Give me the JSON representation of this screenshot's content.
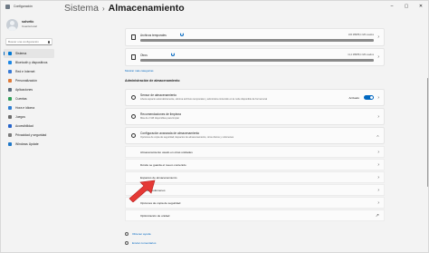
{
  "window": {
    "title": "Configuración",
    "controls": {
      "minimize": "–",
      "maximize": "▢",
      "close": "✕"
    }
  },
  "user": {
    "name": "solvetic",
    "subtitle": "Cuenta local"
  },
  "search": {
    "placeholder": "Buscar una configuración"
  },
  "sidebar": {
    "items": [
      {
        "label": "Sistema",
        "color": "#0078d4",
        "active": true
      },
      {
        "label": "Bluetooth y dispositivos",
        "color": "#1e88e5"
      },
      {
        "label": "Red e Internet",
        "color": "#3a7bd5"
      },
      {
        "label": "Personalización",
        "color": "#e07b39"
      },
      {
        "label": "Aplicaciones",
        "color": "#5a6b7b"
      },
      {
        "label": "Cuentas",
        "color": "#2e9e58"
      },
      {
        "label": "Hora e idioma",
        "color": "#2d7dd2"
      },
      {
        "label": "Juegos",
        "color": "#6b6b6b"
      },
      {
        "label": "Accesibilidad",
        "color": "#2563c9"
      },
      {
        "label": "Privacidad y seguridad",
        "color": "#7a7a7a"
      },
      {
        "label": "Windows Update",
        "color": "#1f78c8"
      }
    ]
  },
  "breadcrumb": {
    "parent": "Sistema",
    "separator": "›",
    "current": "Almacenamiento"
  },
  "storage": {
    "categories": [
      {
        "label": "Archivos temporales",
        "size": "106 MB/88,4 GB usados",
        "fill": 1.0
      },
      {
        "label": "Otros",
        "size": "11,2 MB/88,4 GB usados",
        "fill": 1.0
      }
    ],
    "more_link": "Mostrar más categorías"
  },
  "management": {
    "title": "Administración de almacenamiento",
    "sensor": {
      "title": "Sensor de almacenamiento",
      "desc": "Libera espacio automáticamente, elimina archivos temporales y administra contenido en la nube disponible de forma local",
      "toggle_label": "Activado",
      "toggle_on": true
    },
    "cleanup": {
      "title": "Recomendaciones de limpieza",
      "desc": "Más de 2 GB disponibles para limpiar"
    },
    "advanced": {
      "title": "Configuración avanzada de almacenamiento",
      "desc": "Opciones de copia de seguridad, Espacios de almacenamiento, otros discos y volúmenes",
      "items": [
        {
          "label": "Almacenamiento usado en otras unidades"
        },
        {
          "label": "Dónde se guarda el nuevo contenido"
        },
        {
          "label": "Espacios de almacenamiento"
        },
        {
          "label": "Discos y volúmenes"
        },
        {
          "label": "Opciones de copia de seguridad"
        },
        {
          "label": "Optimización de unidad"
        }
      ]
    }
  },
  "help": {
    "get_help": "Obtener ayuda",
    "feedback": "Enviar comentarios"
  },
  "accent": "#0067c0",
  "pointer_arrow_color": "#e53935"
}
